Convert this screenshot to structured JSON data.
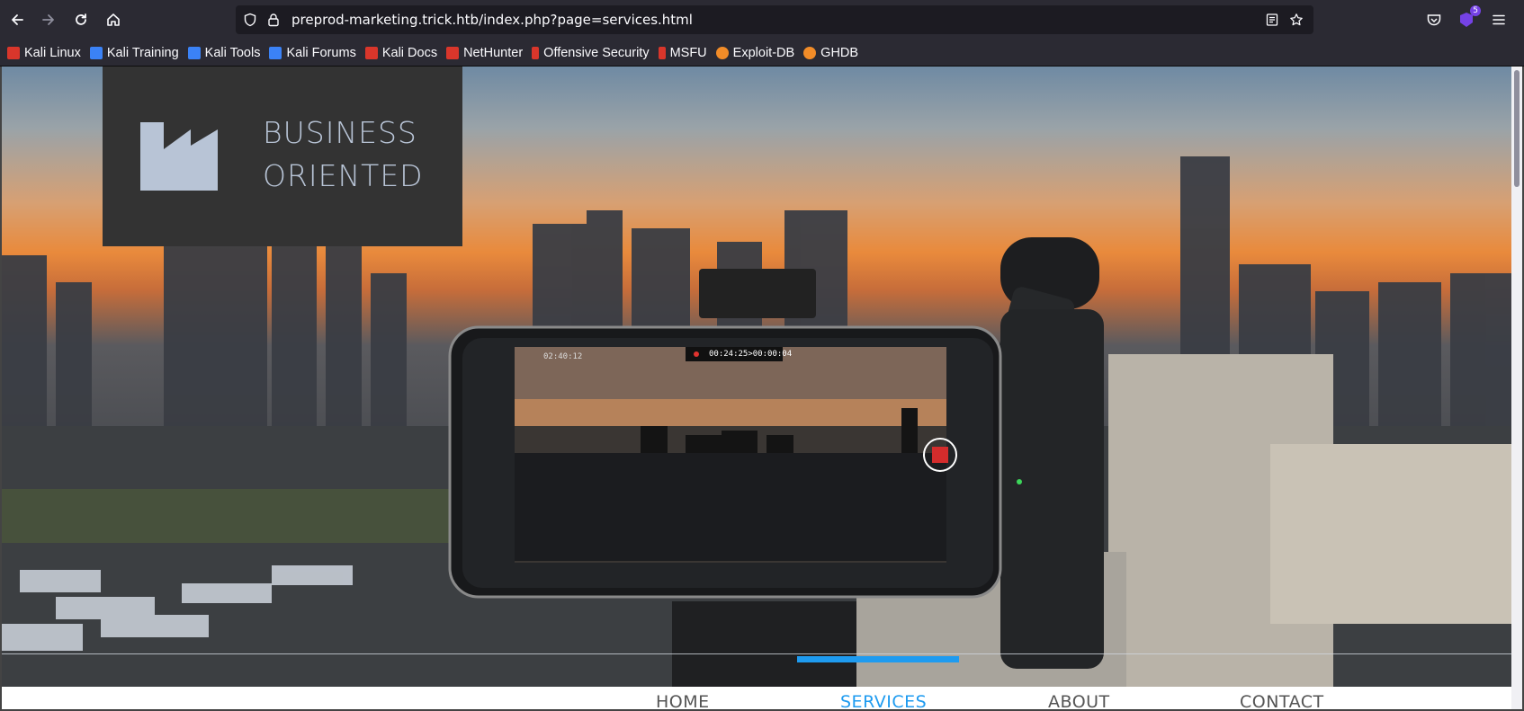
{
  "browser": {
    "url": "preprod-marketing.trick.htb/index.php?page=services.html",
    "extensions_badge": "5"
  },
  "bookmarks": [
    {
      "label": "Kali Linux",
      "icon_color": "#d9362b"
    },
    {
      "label": "Kali Training",
      "icon_color": "#3b82f6"
    },
    {
      "label": "Kali Tools",
      "icon_color": "#3b82f6"
    },
    {
      "label": "Kali Forums",
      "icon_color": "#3b82f6"
    },
    {
      "label": "Kali Docs",
      "icon_color": "#d9362b"
    },
    {
      "label": "NetHunter",
      "icon_color": "#d9362b"
    },
    {
      "label": "Offensive Security",
      "icon_color": "#d9362b"
    },
    {
      "label": "MSFU",
      "icon_color": "#d9362b"
    },
    {
      "label": "Exploit-DB",
      "icon_color": "#f28c28"
    },
    {
      "label": "GHDB",
      "icon_color": "#f28c28"
    }
  ],
  "site": {
    "logo_line1": "BUSINESS",
    "logo_line2": "ORIENTED",
    "menu": {
      "home": "HOME",
      "services": "SERVICES",
      "about": "ABOUT",
      "contact": "CONTACT"
    },
    "active_menu": "services",
    "accent_color": "#1e9bf0",
    "phone_overlay": {
      "storage": "02:40:12",
      "recording": "00:24:25>00:00:04"
    }
  }
}
